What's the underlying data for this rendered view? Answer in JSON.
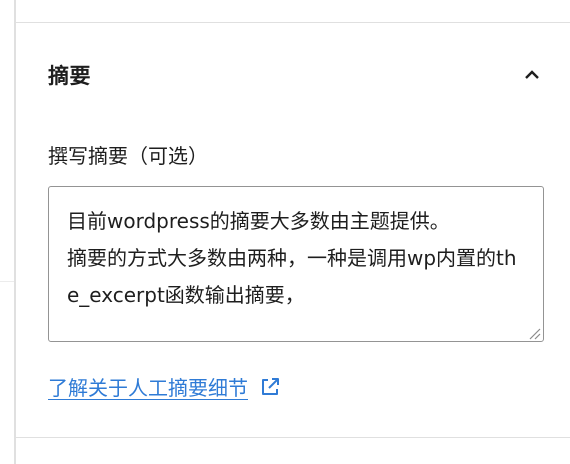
{
  "panel": {
    "title": "摘要",
    "expanded": true
  },
  "excerpt": {
    "label": "撰写摘要（可选）",
    "value": "目前wordpress的摘要大多数由主题提供。\n摘要的方式大多数由两种，一种是调用wp内置的the_excerpt函数输出摘要，"
  },
  "link": {
    "text": "了解关于人工摘要细节",
    "color": "#2f7bd6"
  },
  "icons": {
    "toggle": "chevron-up-icon",
    "external": "external-link-icon",
    "resize": "resize-grip-icon"
  }
}
